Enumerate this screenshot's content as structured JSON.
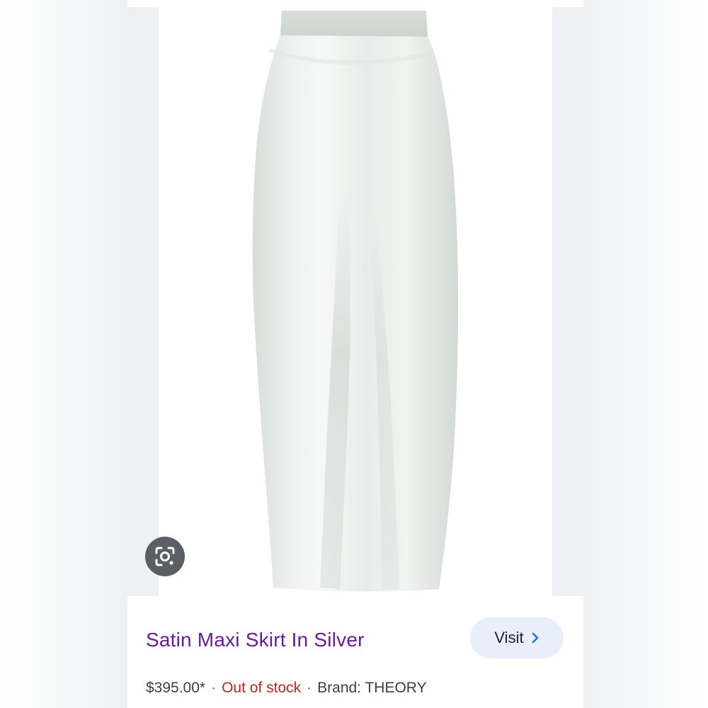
{
  "product": {
    "title": "Satin Maxi Skirt In Silver",
    "price": "$395.00*",
    "separator": "·",
    "stock_status": "Out of stock",
    "brand_text": "Brand: THEORY"
  },
  "visit_button": {
    "label": "Visit",
    "icon": "chevron-right-icon"
  },
  "lens_button": {
    "icon": "google-lens-icon"
  },
  "colors": {
    "title": "#6a1b9a",
    "stock": "#c5221f",
    "visit_bg": "#e8effb",
    "chevron": "#1a73e8",
    "lens_bg": "#5b5e62"
  }
}
